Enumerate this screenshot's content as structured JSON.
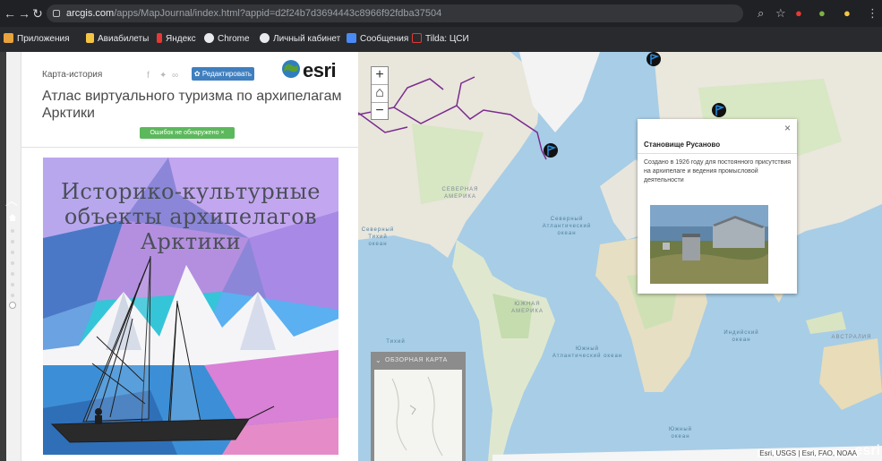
{
  "browser": {
    "url_host": "arcgis.com",
    "url_path": "/apps/MapJournal/index.html?appid=d2f24b7d3694443c8966f92fdba37504"
  },
  "bookmarks": [
    {
      "label": "Приложения",
      "color": "#e8a33d"
    },
    {
      "label": "Авиабилеты",
      "color": "#f4c542"
    },
    {
      "label": "Яндекс",
      "color": "#e53935"
    },
    {
      "label": "Chrome",
      "color": "#e8eaed"
    },
    {
      "label": "Личный кабинет",
      "color": "#e8eaed"
    },
    {
      "label": "Сообщения",
      "color": "#4a8af4"
    },
    {
      "label": "Tilda: ЦСИ",
      "color": "#e53935"
    }
  ],
  "story": {
    "type_label": "Карта-история",
    "edit_button": "✿ Редактировать ×",
    "brand": "esri",
    "title": "Атлас виртуального туризма по архипелагам Арктики",
    "errors_button": "Ошибок не обнаружено ×",
    "poster_title_lines": [
      "Историко-культурные",
      "объекты архипелагов",
      "Арктики"
    ]
  },
  "map": {
    "zoom_in": "+",
    "home": "⌂",
    "zoom_out": "−",
    "labels": [
      {
        "text": "СЕВЕРНАЯ АМЕРИКА",
        "type": "land"
      },
      {
        "text": "Северный Атлантический океан",
        "type": "sea"
      },
      {
        "text": "Северный Тихий океан",
        "type": "sea"
      },
      {
        "text": "ЮЖНАЯ АМЕРИКА",
        "type": "land"
      },
      {
        "text": "Южный Атлантический океан",
        "type": "sea"
      },
      {
        "text": "Индийский океан",
        "type": "sea"
      },
      {
        "text": "АВСТРАЛИЯ",
        "type": "land"
      },
      {
        "text": "Южный океан",
        "type": "sea"
      },
      {
        "text": "Тихий",
        "type": "sea"
      }
    ],
    "popup": {
      "title": "Становище Русаново",
      "text": "Создано в 1926 году для постоянного присутствия на архипелаге и ведения промысловой деятельности",
      "close": "×"
    },
    "overview_title": "ОБЗОРНАЯ КАРТА",
    "attribution": "Esri, USGS | Esri, FAO, NOAA",
    "watermark": "esri"
  }
}
